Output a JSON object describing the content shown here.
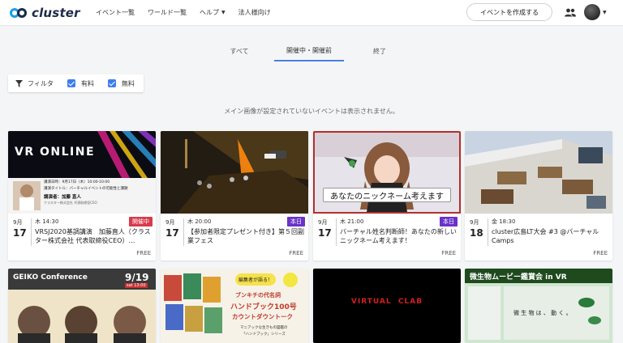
{
  "header": {
    "logo_text": "cluster",
    "nav": [
      {
        "label": "イベント一覧"
      },
      {
        "label": "ワールド一覧"
      },
      {
        "label": "ヘルプ",
        "caret": "▼"
      },
      {
        "label": "法人様向け"
      }
    ],
    "create_label": "イベントを作成する",
    "avatar_caret": "▼"
  },
  "tabs": [
    {
      "label": "すべて"
    },
    {
      "label": "開催中・開催前"
    },
    {
      "label": "終了"
    }
  ],
  "filters": {
    "filter_label": "フィルタ",
    "paid_label": "有料",
    "free_label": "無料"
  },
  "notice": "メイン画像が設定されていないイベントは表示されません。",
  "events": [
    {
      "month": "9月",
      "day": "17",
      "time": "木 14:30",
      "badge": "開催中",
      "title": "VRSJ2020基調講演　加藤直人（クラスター株式会社 代表取締役CEO）…",
      "price": "FREE",
      "thumb_text": "VR ONLINE",
      "thumb_lines": [
        "講演日時：9月17日（木）10:00-10:00",
        "講演タイトル：バーチャルイベントの可能性と課題",
        "講演者：加藤 直人"
      ],
      "thumb_sub": "クラスター株式会社 代表取締役CEO"
    },
    {
      "month": "9月",
      "day": "17",
      "time": "木 20:00",
      "badge": "本日",
      "title": "【参加者限定プレゼント付き】第５回副業フェス",
      "price": "FREE"
    },
    {
      "month": "9月",
      "day": "17",
      "time": "木 21:00",
      "badge": "本日",
      "title": "バーチャル姓名判断師！あなたの新しいニックネーム考えます！",
      "price": "FREE",
      "thumb_text": "あなたのニックネーム考えます"
    },
    {
      "month": "9月",
      "day": "18",
      "time": "金 18:30",
      "badge": "",
      "title": "cluster広島LT大会 #3 @バーチャルCamps",
      "price": "FREE"
    }
  ],
  "bottom_cards": [
    {
      "title": "GEIKO Conference",
      "date": "9/19",
      "time": "sat 13:00"
    },
    {
      "headline_1": "ブンキチの代名詞",
      "headline_2": "ハンドブック100号",
      "headline_3": "カウントダウントーク",
      "bubble": "編集者が語る！",
      "sub_1": "マニアックな生きもの図鑑の",
      "sub_2": "「ハンドブック」シリーズ"
    },
    {
      "title": "VIRTUAL  CLAB"
    },
    {
      "title": "微生物ムービー鑑賞会 in VR",
      "caption": "微 生 物 は 、 動 く 。"
    }
  ],
  "colors": {
    "accent": "#4a7fe0",
    "checkbox": "#3d7df0",
    "live_badge": "#d83a4a",
    "today_badge": "#6a33c9",
    "logo_blue": "#15a0e8",
    "logo_navy": "#1c2a4a"
  }
}
